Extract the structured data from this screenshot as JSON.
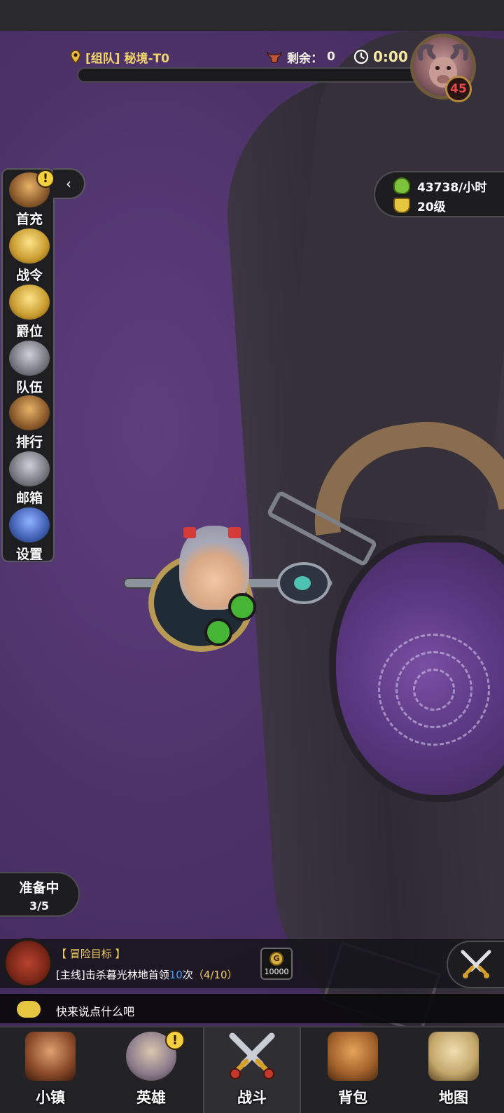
{
  "hud": {
    "stage": "[组队] 秘境-T0",
    "remaining_label": "剩余：",
    "remaining_value": "0",
    "timer": "0:00",
    "boss_level": "45"
  },
  "side_menu": {
    "items": [
      {
        "label": "首充",
        "icon": "treasure-chest-icon",
        "badge": "!"
      },
      {
        "label": "战令",
        "icon": "winged-emblem-icon"
      },
      {
        "label": "爵位",
        "icon": "crown-icon"
      },
      {
        "label": "队伍",
        "icon": "team-faces-icon"
      },
      {
        "label": "排行",
        "icon": "ranking-shield-icon"
      },
      {
        "label": "邮箱",
        "icon": "mail-envelope-icon"
      },
      {
        "label": "设置",
        "icon": "gear-icon"
      }
    ],
    "collapse_glyph": "‹"
  },
  "income": {
    "rate": "43738/小时",
    "level": "20级"
  },
  "ready": {
    "label": "准备中",
    "count": "3/5"
  },
  "quest": {
    "title": "【 冒险目标 】",
    "desc_prefix": "[主线]击杀暮光林地首领",
    "desc_highlight": "10",
    "desc_suffix": "次",
    "progress": "（4/10）",
    "reward_icon_letter": "G",
    "reward_value": "10000"
  },
  "chat": {
    "placeholder": "快来说点什么吧"
  },
  "bottom_nav": {
    "items": [
      {
        "label": "小镇",
        "icon": "town-icon"
      },
      {
        "label": "英雄",
        "icon": "hero-portrait-icon",
        "badge": "!"
      },
      {
        "label": "战斗",
        "icon": "crossed-swords-icon",
        "active": true
      },
      {
        "label": "背包",
        "icon": "backpack-icon"
      },
      {
        "label": "地图",
        "icon": "map-scroll-icon"
      }
    ]
  },
  "colors": {
    "accent_gold": "#f1d56b",
    "highlight_blue": "#3aa0ff",
    "badge_yellow": "#f4d03f",
    "boss_level_red": "#e94b4b"
  }
}
